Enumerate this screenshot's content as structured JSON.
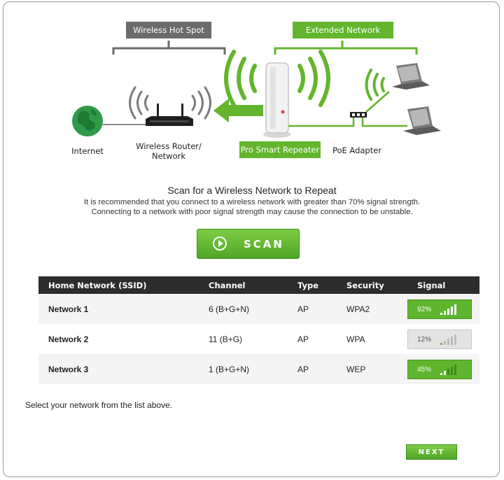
{
  "diagram": {
    "hotspot_tag": "Wireless Hot Spot",
    "extended_tag": "Extended Network",
    "internet_label": "Internet",
    "router_label_1": "Wireless Router/",
    "router_label_2": "Network",
    "repeater_label": "Pro Smart Repeater",
    "poe_label": "PoE Adapter"
  },
  "scan": {
    "heading": "Scan for a Wireless Network to Repeat",
    "line1": "It is recommended that you connect to a wireless network with greater than 70% signal strength.",
    "line2": "Connecting to a network with poor signal strength may cause the connection to be unstable.",
    "button_label": "SCAN"
  },
  "table": {
    "headers": [
      "Home Network (SSID)",
      "Channel",
      "Type",
      "Security",
      "Signal"
    ],
    "rows": [
      {
        "ssid": "Network 1",
        "channel": "6 (B+G+N)",
        "type": "AP",
        "security": "WPA2",
        "signal": "92%",
        "signal_value": 92,
        "quality": "good"
      },
      {
        "ssid": "Network 2",
        "channel": "11 (B+G)",
        "type": "AP",
        "security": "WPA",
        "signal": "12%",
        "signal_value": 12,
        "quality": "poor"
      },
      {
        "ssid": "Network 3",
        "channel": "1 (B+G+N)",
        "type": "AP",
        "security": "WEP",
        "signal": "45%",
        "signal_value": 45,
        "quality": "good"
      }
    ]
  },
  "footer": {
    "instruction": "Select your network from the list above.",
    "next_label": "NEXT"
  },
  "colors": {
    "accent_green": "#63b52d",
    "dark_gray": "#6b6b6b",
    "table_header": "#2c2c2c"
  },
  "icons": {
    "internet": "globe-icon",
    "router": "router-icon",
    "repeater": "repeater-icon",
    "poe": "poe-adapter-icon",
    "laptop": "laptop-icon",
    "arrow": "arrow-left-icon",
    "wifi": "wifi-waves-icon"
  }
}
